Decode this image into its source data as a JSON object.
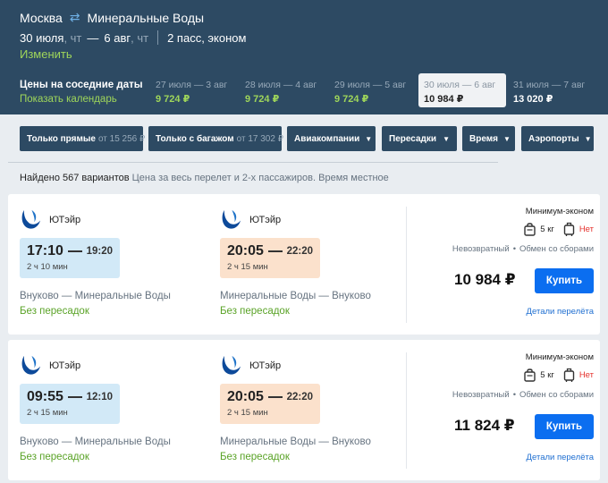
{
  "header": {
    "origin": "Москва",
    "destination": "Минеральные Воды",
    "swap_icon": "swap-arrows-icon",
    "date_out": "30 июля",
    "day_out": ", чт",
    "date_sep": "—",
    "date_back": "6 авг",
    "day_back": ", чт",
    "passengers": "2 пасс, эконом",
    "change_label": "Изменить"
  },
  "nearby": {
    "title": "Цены на соседние даты",
    "calendar_link": "Показать календарь",
    "dates": [
      {
        "range": "27 июля — 3 авг",
        "price": "9 724 ₽"
      },
      {
        "range": "28 июля — 4 авг",
        "price": "9 724 ₽"
      },
      {
        "range": "29 июля — 5 авг",
        "price": "9 724 ₽"
      },
      {
        "range": "30 июля — 6 авг",
        "price": "10 984 ₽"
      },
      {
        "range": "31 июля — 7 авг",
        "price": "13 020 ₽"
      }
    ]
  },
  "filters": {
    "direct": {
      "label": "Только прямые",
      "price": "от 15 256 ₽"
    },
    "baggage": {
      "label": "Только с багажом",
      "price": "от 17 302 ₽"
    },
    "airlines": "Авиакомпании",
    "transfers": "Пересадки",
    "time": "Время",
    "airports": "Аэропорты"
  },
  "results": {
    "count": "Найдено 567 вариантов",
    "note": "Цена за весь перелет и 2-х пассажиров. Время местное"
  },
  "colors": {
    "header": "#2d4a63",
    "accent_green": "#9fd65a",
    "buy_button": "#0b6ef0",
    "no_red": "#e5322d"
  },
  "offers": [
    {
      "out": {
        "airline": "ЮТэйр",
        "dep": "17:10",
        "arr": "19:20",
        "duration": "2 ч 10 мин",
        "airports": "Внуково — Минеральные Воды",
        "stops": "Без пересадок"
      },
      "back": {
        "airline": "ЮТэйр",
        "dep": "20:05",
        "arr": "22:20",
        "duration": "2 ч 15 мин",
        "airports": "Минеральные Воды — Внуково",
        "stops": "Без пересадок"
      },
      "tariff": "Минимум-эконом",
      "hand_bag": "5 кг",
      "baggage": "Нет",
      "refund": "Невозвратный",
      "exchange": "Обмен со сборами",
      "price": "10 984 ₽",
      "buy_label": "Купить",
      "details_label": "Детали перелёта"
    },
    {
      "out": {
        "airline": "ЮТэйр",
        "dep": "09:55",
        "arr": "12:10",
        "duration": "2 ч 15 мин",
        "airports": "Внуково — Минеральные Воды",
        "stops": "Без пересадок"
      },
      "back": {
        "airline": "ЮТэйр",
        "dep": "20:05",
        "arr": "22:20",
        "duration": "2 ч 15 мин",
        "airports": "Минеральные Воды — Внуково",
        "stops": "Без пересадок"
      },
      "tariff": "Минимум-эконом",
      "hand_bag": "5 кг",
      "baggage": "Нет",
      "refund": "Невозвратный",
      "exchange": "Обмен со сборами",
      "price": "11 824 ₽",
      "buy_label": "Купить",
      "details_label": "Детали перелёта"
    }
  ]
}
